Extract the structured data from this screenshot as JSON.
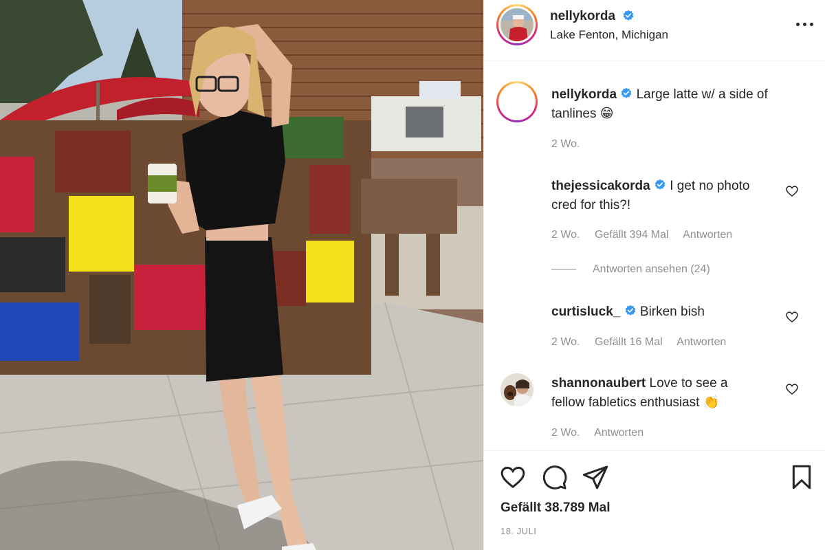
{
  "post": {
    "author": "nellykorda",
    "location": "Lake Fenton, Michigan",
    "caption": "Large latte w/ a side of tanlines 😁",
    "caption_lines": [
      "Large latte w/ a side of",
      "tanlines"
    ],
    "caption_emoji": "😁",
    "caption_age": "2 Wo.",
    "likes_text": "Gefällt 38.789 Mal",
    "date": "18. JULI"
  },
  "comments": [
    {
      "user": "thejessicakorda",
      "verified": true,
      "line1": "I get no photo",
      "line2": "cred for this?!",
      "age": "2 Wo.",
      "likes": "Gefällt 394 Mal",
      "reply": "Antworten",
      "view_replies": "Antworten ansehen (24)"
    },
    {
      "user": "curtisluck_",
      "verified": true,
      "line1": "Birken bish",
      "age": "2 Wo.",
      "likes": "Gefällt 16 Mal",
      "reply": "Antworten"
    },
    {
      "user": "shannonaubert",
      "verified": false,
      "line1": "Love to see a",
      "line2": "fellow fabletics enthusiast",
      "emoji": "👏",
      "age": "2 Wo.",
      "reply": "Antworten"
    }
  ],
  "icons": {
    "verified": "verified-badge-icon",
    "more": "more-options-icon",
    "like": "heart-icon",
    "comment": "comment-icon",
    "share": "share-icon",
    "save": "bookmark-icon"
  },
  "colors": {
    "verified_blue": "#3897f0",
    "text": "#262626",
    "muted": "#8e8e8e",
    "border": "#efefef"
  }
}
